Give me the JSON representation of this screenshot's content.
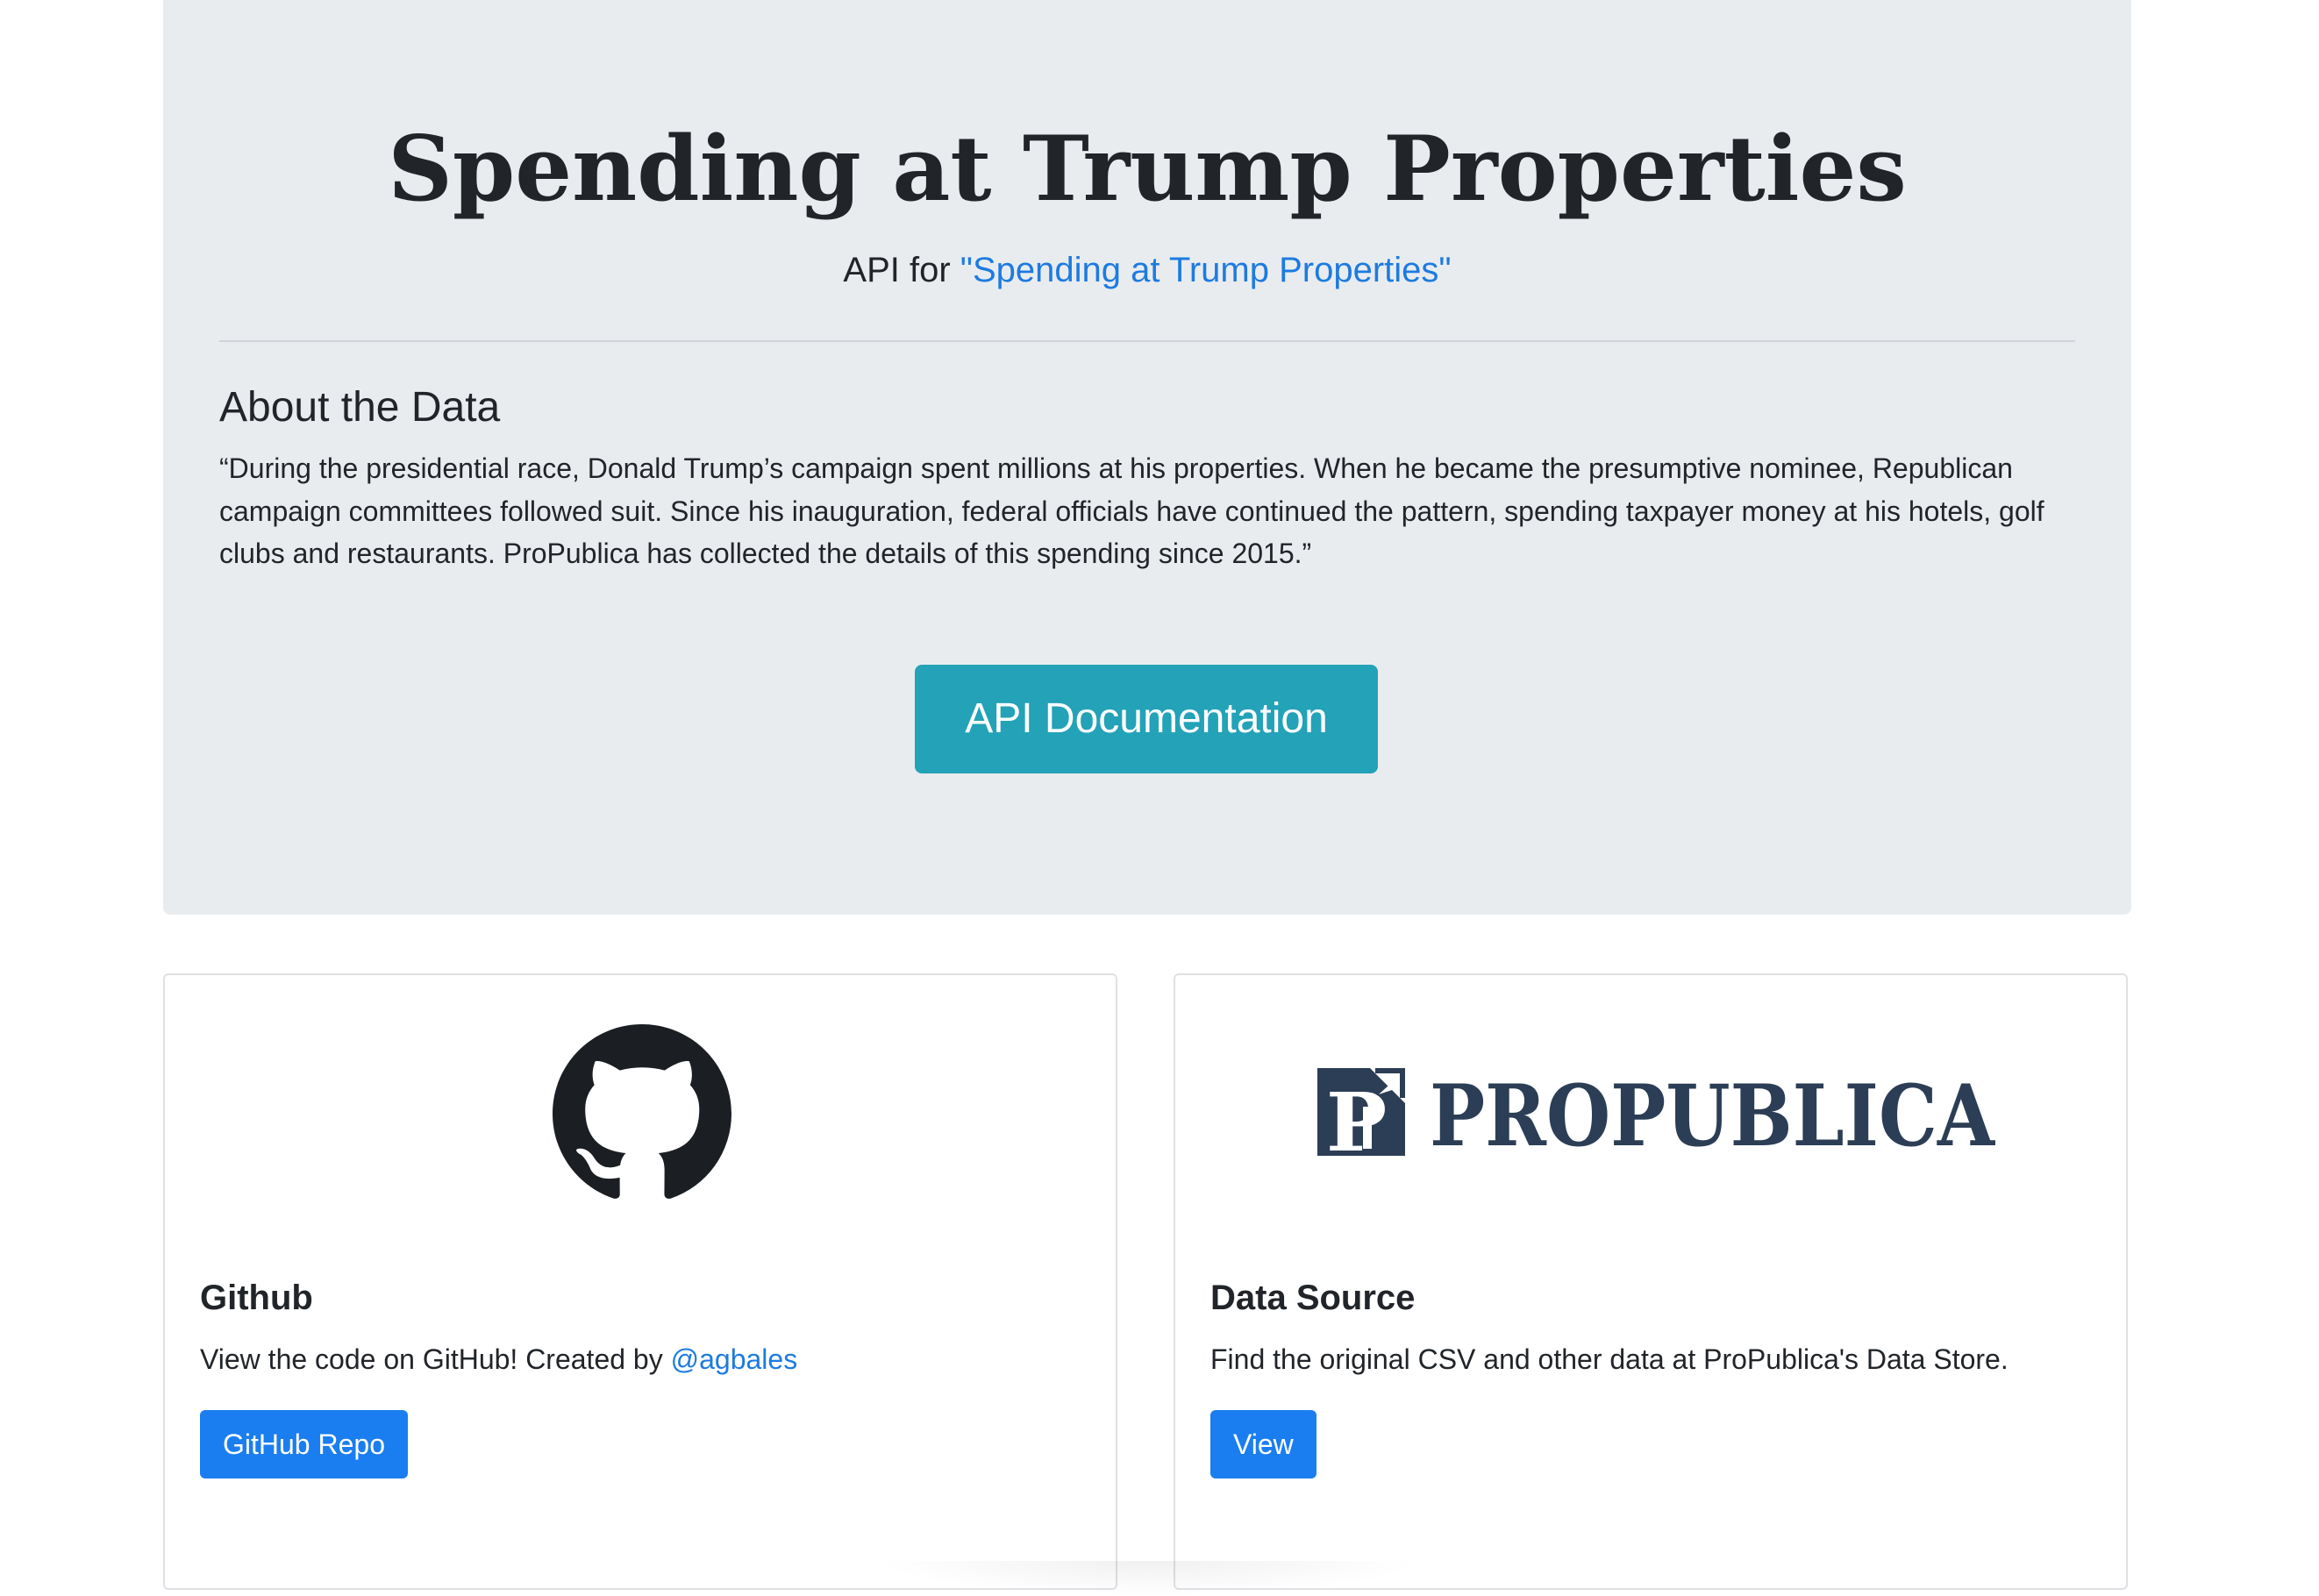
{
  "hero": {
    "title": "Spending at Trump Properties",
    "subtitle_prefix": "API for ",
    "subtitle_link": "\"Spending at Trump Properties\"",
    "about_heading": "About the Data",
    "about_text": "“During the presidential race, Donald Trump’s campaign spent millions at his properties. When he became the presumptive nominee, Republican campaign committees followed suit. Since his inauguration, federal officials have continued the pattern, spending taxpayer money at his hotels, golf clubs and restaurants. ProPublica has collected the details of this spending since 2015.”",
    "api_button_label": "API Documentation"
  },
  "cards": {
    "github": {
      "logo_icon": "github-octocat-icon",
      "title": "Github",
      "text_prefix": "View the code on GitHub! Created by ",
      "author_link": "@agbales",
      "button_label": "GitHub Repo"
    },
    "data_source": {
      "logo_icon": "propublica-logo",
      "logo_text": "PROPUBLICA",
      "title": "Data Source",
      "text": "Find the original CSV and other data at ProPublica's Data Store.",
      "button_label": "View"
    }
  },
  "colors": {
    "jumbotron_bg": "#e9ecef",
    "link": "#1d7be0",
    "api_button": "#23a2b8",
    "primary_button": "#1a7ef0",
    "propublica_navy": "#2c3e55"
  }
}
